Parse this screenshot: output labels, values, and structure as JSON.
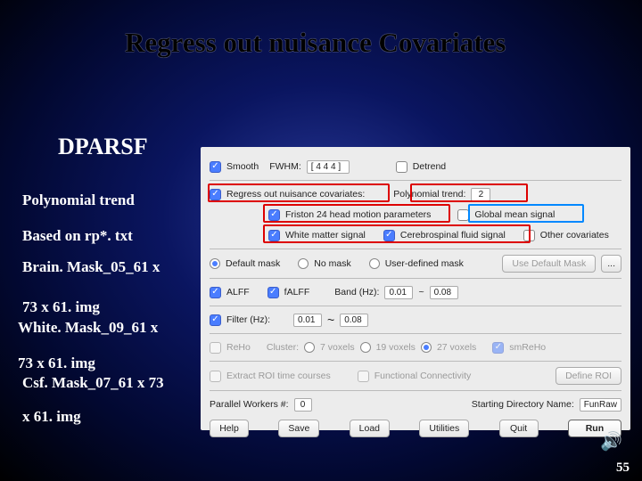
{
  "title": "Regress out nuisance Covariates",
  "left": {
    "dparsf": "DPARSF",
    "poly": "Polynomial trend",
    "based": "Based on rp*. txt",
    "brain": "Brain. Mask_05_61 x",
    "sev1": "73 x 61. img",
    "white": "White. Mask_09_61 x",
    "sev2": "73 x 61. img",
    "csf": "Csf. Mask_07_61 x 73",
    "x61": "x 61. img"
  },
  "panel": {
    "smooth_lbl": "Smooth",
    "fwhm_lbl": "FWHM:",
    "fwhm_val": "[ 4 4 4 ]",
    "detrend_lbl": "Detrend",
    "regress_lbl": "Regress out nuisance covariates:",
    "polytrend_lbl": "Polynomial trend:",
    "polytrend_val": "2",
    "friston_lbl": "Friston 24 head motion parameters",
    "global_lbl": "Global mean signal",
    "wm_lbl": "White matter signal",
    "csf_lbl": "Cerebrospinal fluid signal",
    "other_lbl": "Other covariates",
    "defmask_lbl": "Default mask",
    "nomask_lbl": "No mask",
    "usermask_lbl": "User-defined mask",
    "usedef_btn": "Use Default Mask",
    "dots_btn": "...",
    "alff_lbl": "ALFF",
    "falff_lbl": "fALFF",
    "band_lbl": "Band (Hz):",
    "band_lo": "0.01",
    "band_tilde": "~",
    "band_hi": "0.08",
    "filter_lbl": "Filter (Hz):",
    "filt_lo": "0.01",
    "filt_hi": "0.08",
    "reho_lbl": "ReHo",
    "cluster_lbl": "Cluster:",
    "c7": "7 voxels",
    "c19": "19 voxels",
    "c27": "27 voxels",
    "smreho_lbl": "smReHo",
    "roi_lbl": "Extract ROI time courses",
    "fc_lbl": "Functional Connectivity",
    "defroi_btn": "Define ROI",
    "workers_lbl": "Parallel Workers #:",
    "workers_val": "0",
    "startdir_lbl": "Starting Directory Name:",
    "startdir_val": "FunRaw",
    "btn_help": "Help",
    "btn_save": "Save",
    "btn_load": "Load",
    "btn_util": "Utilities",
    "btn_quit": "Quit",
    "btn_run": "Run"
  },
  "page": "55"
}
